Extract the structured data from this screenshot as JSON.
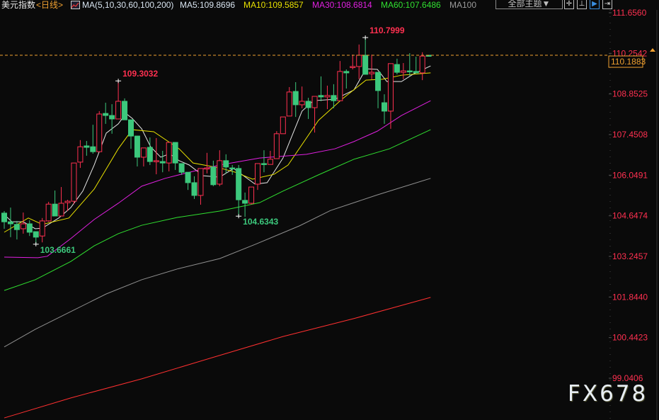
{
  "header": {
    "title": "美元指数",
    "period": "<日线>",
    "ma_label": "MA(5,10,30,60,100,200)",
    "ma5": "MA5:109.8696",
    "ma10": "MA10:109.5857",
    "ma30": "MA30:108.6814",
    "ma60": "MA60:107.6486",
    "ma100": "MA100",
    "theme_button": "全部主题▼",
    "icons": [
      "crosshair-icon",
      "range-icon",
      "play-icon",
      "export-icon"
    ]
  },
  "colors": {
    "up": "#ff3050",
    "down": "#3cc87c",
    "ma5": "#e6e6e6",
    "ma10": "#e8e000",
    "ma30": "#e020e0",
    "ma60": "#30e030",
    "ma100": "#909090",
    "ma200": "#ff3030",
    "axis": "#ff3050",
    "current": "#f0a030"
  },
  "chart_data": {
    "type": "candlestick",
    "title": "美元指数 <日线>",
    "ylim": [
      99.0406,
      111.656
    ],
    "y_ticks": [
      "111.6560",
      "110.2542",
      "108.8525",
      "107.4508",
      "106.0491",
      "104.6474",
      "103.2457",
      "101.8440",
      "100.4423",
      "99.0406"
    ],
    "current_price": "110.1883",
    "candles_ohlc": [
      [
        104.74,
        104.81,
        104.2,
        104.44
      ],
      [
        104.44,
        104.93,
        103.91,
        104.37
      ],
      [
        104.35,
        104.47,
        103.83,
        104.17
      ],
      [
        104.2,
        104.76,
        104.03,
        104.37
      ],
      [
        104.37,
        104.49,
        103.95,
        104.08
      ],
      [
        104.1,
        104.1,
        103.67,
        103.91
      ],
      [
        103.95,
        104.57,
        103.73,
        104.47
      ],
      [
        104.47,
        105.13,
        104.44,
        105.05
      ],
      [
        105.05,
        105.52,
        104.64,
        104.64
      ],
      [
        104.64,
        105.64,
        104.64,
        105.08
      ],
      [
        105.1,
        105.2,
        104.81,
        105.15
      ],
      [
        105.15,
        106.47,
        105.05,
        106.47
      ],
      [
        106.5,
        107.26,
        106.3,
        107.03
      ],
      [
        107.06,
        107.23,
        106.72,
        107.01
      ],
      [
        107.03,
        107.79,
        106.79,
        106.86
      ],
      [
        106.86,
        108.26,
        106.86,
        108.16
      ],
      [
        108.18,
        108.55,
        107.82,
        108.11
      ],
      [
        108.11,
        108.5,
        107.48,
        107.99
      ],
      [
        107.99,
        109.3,
        107.99,
        108.6
      ],
      [
        108.6,
        108.7,
        107.96,
        107.96
      ],
      [
        107.96,
        107.96,
        106.96,
        107.4
      ],
      [
        107.4,
        107.4,
        106.35,
        106.67
      ],
      [
        106.67,
        106.99,
        106.35,
        106.99
      ],
      [
        107.01,
        107.35,
        106.4,
        106.52
      ],
      [
        106.52,
        107.33,
        106.08,
        106.55
      ],
      [
        106.52,
        106.89,
        106.15,
        106.47
      ],
      [
        106.47,
        107.18,
        106.18,
        107.18
      ],
      [
        107.18,
        107.18,
        106.23,
        106.47
      ],
      [
        106.45,
        106.45,
        106.06,
        106.15
      ],
      [
        106.15,
        106.15,
        105.54,
        105.79
      ],
      [
        105.79,
        106.01,
        105.23,
        105.35
      ],
      [
        105.35,
        106.28,
        105.03,
        106.28
      ],
      [
        106.28,
        106.82,
        106.11,
        106.3
      ],
      [
        106.33,
        106.55,
        105.67,
        105.72
      ],
      [
        105.74,
        106.91,
        105.67,
        106.55
      ],
      [
        106.55,
        106.77,
        106.11,
        106.33
      ],
      [
        106.3,
        106.4,
        106.06,
        106.28
      ],
      [
        106.28,
        106.4,
        104.63,
        105.2
      ],
      [
        105.18,
        105.45,
        104.61,
        105.08
      ],
      [
        105.08,
        105.64,
        105.03,
        105.64
      ],
      [
        105.74,
        106.45,
        105.54,
        106.45
      ],
      [
        106.45,
        106.91,
        106.15,
        106.42
      ],
      [
        106.42,
        106.89,
        106.42,
        106.6
      ],
      [
        106.62,
        107.57,
        106.62,
        107.48
      ],
      [
        107.48,
        108.06,
        107.48,
        108.06
      ],
      [
        108.09,
        109.09,
        108.09,
        108.92
      ],
      [
        108.94,
        109.26,
        108.06,
        108.48
      ],
      [
        108.48,
        109.11,
        108.36,
        108.6
      ],
      [
        108.6,
        108.72,
        107.99,
        108.38
      ],
      [
        108.38,
        108.77,
        107.52,
        108.77
      ],
      [
        108.8,
        109.46,
        108.6,
        108.75
      ],
      [
        108.75,
        109.14,
        108.33,
        108.8
      ],
      [
        108.8,
        109.19,
        108.36,
        108.62
      ],
      [
        108.62,
        109.99,
        108.62,
        109.63
      ],
      [
        109.63,
        109.7,
        109.04,
        109.58
      ],
      [
        109.77,
        110.21,
        109.7,
        109.8
      ],
      [
        109.8,
        110.56,
        109.36,
        110.19
      ],
      [
        110.19,
        110.8,
        109.53,
        109.53
      ],
      [
        109.55,
        110.21,
        109.36,
        109.6
      ],
      [
        109.6,
        109.6,
        108.36,
        108.97
      ],
      [
        108.55,
        108.84,
        107.82,
        108.26
      ],
      [
        108.26,
        109.9,
        107.65,
        109.9
      ],
      [
        109.87,
        110.07,
        109.53,
        109.6
      ],
      [
        109.6,
        109.92,
        109.36,
        109.65
      ],
      [
        109.65,
        110.26,
        109.48,
        109.63
      ],
      [
        109.63,
        110.14,
        109.58,
        109.58
      ],
      [
        109.58,
        110.29,
        109.33,
        110.16
      ],
      [
        110.19,
        110.2,
        110.17,
        110.19
      ]
    ],
    "ma_series": [
      {
        "name": "MA5",
        "color_key": "ma5",
        "points": [
          [
            0,
            104.69
          ],
          [
            1.2,
            104.44
          ],
          [
            3,
            104.44
          ],
          [
            4.9,
            104.2
          ],
          [
            6,
            104.22
          ],
          [
            8.6,
            104.57
          ],
          [
            10.5,
            104.93
          ],
          [
            12.4,
            105.5
          ],
          [
            14.2,
            106.4
          ],
          [
            16.1,
            107.5
          ],
          [
            18,
            107.82
          ],
          [
            19.2,
            108.18
          ],
          [
            20.2,
            108.01
          ],
          [
            21.7,
            107.65
          ],
          [
            23.1,
            107.03
          ],
          [
            24.7,
            106.67
          ],
          [
            26.1,
            106.79
          ],
          [
            27.6,
            106.55
          ],
          [
            29.2,
            106.4
          ],
          [
            31.4,
            106.03
          ],
          [
            34,
            105.98
          ],
          [
            36.2,
            106.28
          ],
          [
            39.6,
            105.74
          ],
          [
            41.5,
            105.79
          ],
          [
            44,
            106.64
          ],
          [
            47,
            108.26
          ],
          [
            48.8,
            108.62
          ],
          [
            52.2,
            108.67
          ],
          [
            55.2,
            108.99
          ],
          [
            57.1,
            109.72
          ],
          [
            58.9,
            109.7
          ],
          [
            60.4,
            109.28
          ],
          [
            62.7,
            109.28
          ],
          [
            64.5,
            109.53
          ],
          [
            67.3,
            109.82
          ]
        ]
      },
      {
        "name": "MA10",
        "color_key": "ma10",
        "points": [
          [
            0,
            104.08
          ],
          [
            3.8,
            104.57
          ],
          [
            6,
            104.35
          ],
          [
            10.2,
            104.57
          ],
          [
            14.2,
            105.57
          ],
          [
            18,
            106.96
          ],
          [
            20.2,
            107.62
          ],
          [
            23.6,
            107.55
          ],
          [
            27.6,
            106.96
          ],
          [
            29.8,
            106.47
          ],
          [
            34,
            106.3
          ],
          [
            36.5,
            106.15
          ],
          [
            39.2,
            105.91
          ],
          [
            42.6,
            106.08
          ],
          [
            44.8,
            106.4
          ],
          [
            49.6,
            107.94
          ],
          [
            53.3,
            108.67
          ],
          [
            57.1,
            109.33
          ],
          [
            59.7,
            109.36
          ],
          [
            62.7,
            109.5
          ],
          [
            67.3,
            109.58
          ]
        ]
      },
      {
        "name": "MA30",
        "color_key": "ma30",
        "points": [
          [
            0,
            103.22
          ],
          [
            5.3,
            103.2
          ],
          [
            6.8,
            103.25
          ],
          [
            10.5,
            103.86
          ],
          [
            14.2,
            104.52
          ],
          [
            18,
            105.08
          ],
          [
            21.7,
            105.67
          ],
          [
            25.4,
            105.94
          ],
          [
            29.2,
            106.15
          ],
          [
            34,
            106.4
          ],
          [
            40.3,
            106.64
          ],
          [
            47.7,
            106.77
          ],
          [
            52.2,
            106.96
          ],
          [
            55.2,
            107.21
          ],
          [
            58.9,
            107.57
          ],
          [
            62.7,
            108.11
          ],
          [
            67.3,
            108.62
          ]
        ]
      },
      {
        "name": "MA60",
        "color_key": "ma60",
        "points": [
          [
            0,
            102.07
          ],
          [
            4.9,
            102.44
          ],
          [
            10.5,
            103.07
          ],
          [
            14.2,
            103.61
          ],
          [
            18,
            104.03
          ],
          [
            21.7,
            104.32
          ],
          [
            27.3,
            104.59
          ],
          [
            34,
            104.81
          ],
          [
            40.3,
            105.1
          ],
          [
            44,
            105.5
          ],
          [
            49.6,
            106.06
          ],
          [
            55.2,
            106.6
          ],
          [
            60.8,
            106.96
          ],
          [
            67.3,
            107.62
          ]
        ]
      },
      {
        "name": "MA100",
        "color_key": "ma100",
        "points": [
          [
            0,
            100.12
          ],
          [
            4.9,
            100.73
          ],
          [
            10.5,
            101.34
          ],
          [
            16.1,
            101.95
          ],
          [
            21.7,
            102.44
          ],
          [
            27.3,
            102.81
          ],
          [
            34,
            103.17
          ],
          [
            39.6,
            103.66
          ],
          [
            46.6,
            104.3
          ],
          [
            51.5,
            104.83
          ],
          [
            58.9,
            105.37
          ],
          [
            67.3,
            105.94
          ]
        ]
      },
      {
        "name": "MA200",
        "color_key": "ma200",
        "points": [
          [
            0,
            97.67
          ],
          [
            10.5,
            98.36
          ],
          [
            21.7,
            99.02
          ],
          [
            32.8,
            99.75
          ],
          [
            44,
            100.48
          ],
          [
            55.2,
            101.1
          ],
          [
            67.3,
            101.83
          ]
        ]
      }
    ],
    "annotations": [
      {
        "text": "109.3032",
        "index": 18,
        "price": 109.3032,
        "kind": "high"
      },
      {
        "text": "110.7999",
        "index": 57,
        "price": 110.7999,
        "kind": "high"
      },
      {
        "text": "104.6343",
        "index": 37,
        "price": 104.6343,
        "kind": "low"
      },
      {
        "text": "103.6661",
        "index": 5,
        "price": 103.6661,
        "kind": "low"
      }
    ]
  },
  "watermark": "FX678"
}
